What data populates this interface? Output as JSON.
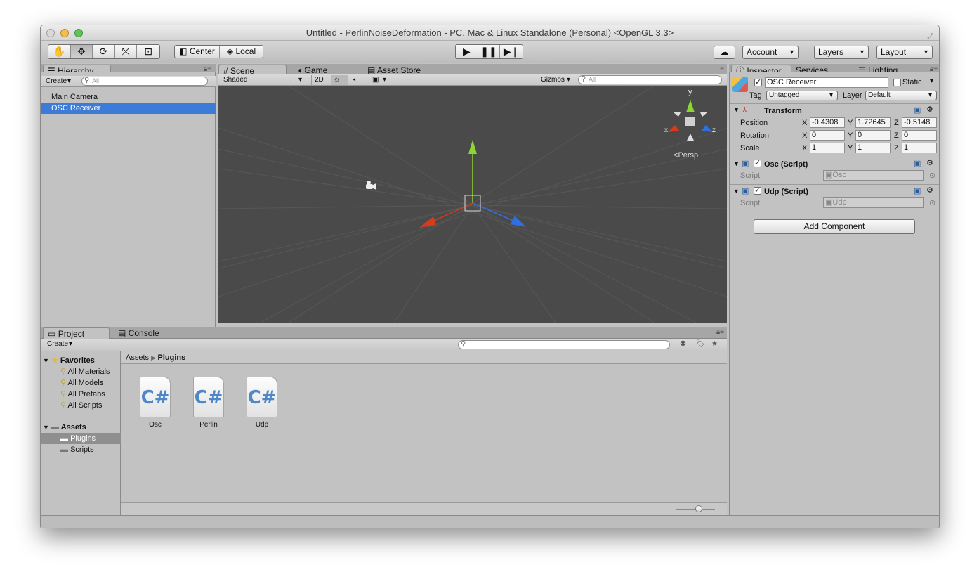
{
  "window": {
    "title": "Untitled - PerlinNoiseDeformation - PC, Mac & Linux Standalone (Personal) <OpenGL 3.3>"
  },
  "toolbar": {
    "transform_tools": [
      "hand-icon",
      "move-icon",
      "rotate-icon",
      "scale-icon",
      "rect-icon"
    ],
    "pivot_label": "Center",
    "space_label": "Local",
    "account_label": "Account",
    "layers_label": "Layers",
    "layout_label": "Layout"
  },
  "hierarchy": {
    "tab_label": "Hierarchy",
    "create_label": "Create",
    "search_placeholder": "All",
    "items": [
      {
        "label": "Main Camera"
      },
      {
        "label": "OSC Receiver"
      }
    ]
  },
  "scene": {
    "tabs": [
      {
        "label": "Scene"
      },
      {
        "label": "Game"
      },
      {
        "label": "Asset Store"
      }
    ],
    "shading_label": "Shaded",
    "mode_2d_label": "2D",
    "gizmos_label": "Gizmos",
    "search_placeholder": "All",
    "persp_label": "Persp",
    "axes": {
      "y": "y",
      "x": "x",
      "z": "z"
    }
  },
  "inspector": {
    "tabs": [
      {
        "label": "Inspector"
      },
      {
        "label": "Services"
      },
      {
        "label": "Lighting"
      }
    ],
    "object_name": "OSC Receiver",
    "static_label": "Static",
    "tag_label": "Tag",
    "tag_value": "Untagged",
    "layer_label": "Layer",
    "layer_value": "Default",
    "transform": {
      "title": "Transform",
      "position_label": "Position",
      "rotation_label": "Rotation",
      "scale_label": "Scale",
      "axis_x": "X",
      "axis_y": "Y",
      "axis_z": "Z",
      "position": {
        "x": "-0.4308",
        "y": "1.72645",
        "z": "-0.5148"
      },
      "rotation": {
        "x": "0",
        "y": "0",
        "z": "0"
      },
      "scale": {
        "x": "1",
        "y": "1",
        "z": "1"
      }
    },
    "components": [
      {
        "title": "Osc (Script)",
        "script_label": "Script",
        "script_value": "Osc"
      },
      {
        "title": "Udp (Script)",
        "script_label": "Script",
        "script_value": "Udp"
      }
    ],
    "add_component_label": "Add Component"
  },
  "project": {
    "tabs": [
      {
        "label": "Project"
      },
      {
        "label": "Console"
      }
    ],
    "create_label": "Create",
    "breadcrumb": {
      "root": "Assets",
      "current": "Plugins"
    },
    "favorites_label": "Favorites",
    "favorites": [
      {
        "label": "All Materials"
      },
      {
        "label": "All Models"
      },
      {
        "label": "All Prefabs"
      },
      {
        "label": "All Scripts"
      }
    ],
    "assets_label": "Assets",
    "folders": [
      {
        "label": "Plugins"
      },
      {
        "label": "Scripts"
      }
    ],
    "files": [
      {
        "name": "Osc",
        "icon": "C#"
      },
      {
        "name": "Perlin",
        "icon": "C#"
      },
      {
        "name": "Udp",
        "icon": "C#"
      }
    ]
  },
  "colors": {
    "selection": "#3d7bd9",
    "scene_bg": "#4a4a4a",
    "axis_x": "#d83a1c",
    "axis_y": "#8cd62f",
    "axis_z": "#2f6fe0"
  }
}
